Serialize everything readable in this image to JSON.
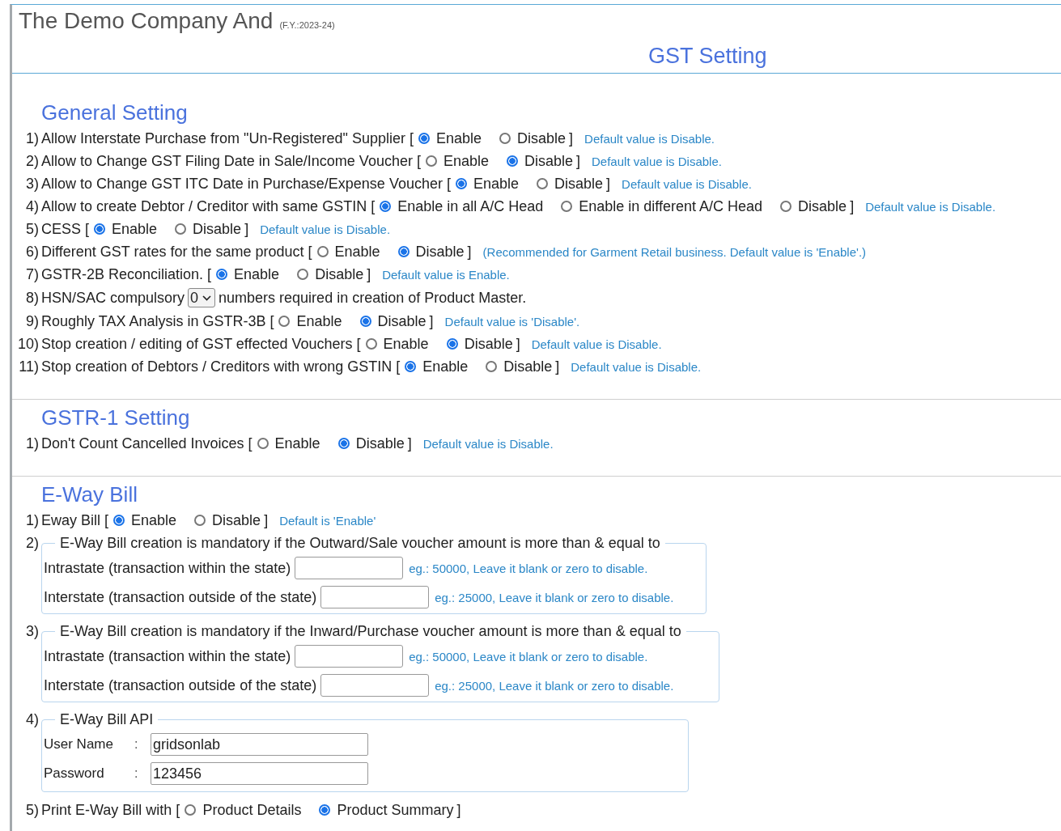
{
  "company": {
    "name": "The Demo Company And",
    "fy": "(F.Y.:2023-24)"
  },
  "page_title": "GST Setting",
  "sections": [
    {
      "title": "General Setting",
      "items": [
        {
          "kind": "radio",
          "number": "1)",
          "label": "Allow Interstate Purchase from \"Un-Registered\" Supplier [",
          "options": [
            {
              "label": "Enable",
              "selected": true
            },
            {
              "label": "Disable",
              "selected": false
            }
          ],
          "close": "]",
          "note": "Default value is Disable."
        },
        {
          "kind": "radio",
          "number": "2)",
          "label": "Allow to Change GST Filing Date in Sale/Income Voucher [",
          "options": [
            {
              "label": "Enable",
              "selected": false
            },
            {
              "label": "Disable",
              "selected": true
            }
          ],
          "close": "]",
          "note": "Default value is Disable."
        },
        {
          "kind": "radio",
          "number": "3)",
          "label": "Allow to Change GST ITC Date in Purchase/Expense Voucher [",
          "options": [
            {
              "label": "Enable",
              "selected": true
            },
            {
              "label": "Disable",
              "selected": false
            }
          ],
          "close": "]",
          "note": "Default value is Disable."
        },
        {
          "kind": "radio",
          "number": "4)",
          "label": "Allow to create Debtor / Creditor with same GSTIN [",
          "options": [
            {
              "label": "Enable in all A/C Head",
              "selected": true
            },
            {
              "label": "Enable in different A/C Head",
              "selected": false
            },
            {
              "label": "Disable",
              "selected": false
            }
          ],
          "close": "]",
          "note": "Default value is Disable."
        },
        {
          "kind": "radio",
          "number": "5)",
          "label": "CESS [",
          "options": [
            {
              "label": "Enable",
              "selected": true
            },
            {
              "label": "Disable",
              "selected": false
            }
          ],
          "close": "]",
          "note": "Default value is Disable."
        },
        {
          "kind": "radio",
          "number": "6)",
          "label": "Different GST rates for the same product [",
          "options": [
            {
              "label": "Enable",
              "selected": false
            },
            {
              "label": "Disable",
              "selected": true
            }
          ],
          "close": "]",
          "note": "(Recommended for Garment Retail business. Default value is 'Enable'.)"
        },
        {
          "kind": "radio",
          "number": "7)",
          "label": "GSTR-2B Reconciliation. [",
          "options": [
            {
              "label": "Enable",
              "selected": true
            },
            {
              "label": "Disable",
              "selected": false
            }
          ],
          "close": "]",
          "note": "Default value is Enable."
        },
        {
          "kind": "select",
          "number": "8)",
          "label": "HSN/SAC compulsory",
          "value": "0",
          "after": "numbers required in creation of Product Master."
        },
        {
          "kind": "radio",
          "number": "9)",
          "label": "Roughly TAX Analysis in GSTR-3B [",
          "options": [
            {
              "label": "Enable",
              "selected": false
            },
            {
              "label": "Disable",
              "selected": true
            }
          ],
          "close": "]",
          "note": "Default value is 'Disable'."
        },
        {
          "kind": "radio",
          "number": "10)",
          "label": "Stop creation / editing of GST effected Vouchers [",
          "options": [
            {
              "label": "Enable",
              "selected": false
            },
            {
              "label": "Disable",
              "selected": true
            }
          ],
          "close": "]",
          "note": "Default value is Disable."
        },
        {
          "kind": "radio",
          "number": "11)",
          "label": "Stop creation of Debtors / Creditors with wrong GSTIN [",
          "options": [
            {
              "label": "Enable",
              "selected": true
            },
            {
              "label": "Disable",
              "selected": false
            }
          ],
          "close": "]",
          "note": "Default value is Disable."
        }
      ]
    },
    {
      "title": "GSTR-1 Setting",
      "items": [
        {
          "kind": "radio",
          "number": "1)",
          "label": "Don't Count Cancelled Invoices [",
          "options": [
            {
              "label": "Enable",
              "selected": false
            },
            {
              "label": "Disable",
              "selected": true
            }
          ],
          "close": "]",
          "note": "Default value is Disable."
        }
      ]
    },
    {
      "title": "E-Way Bill",
      "items": [
        {
          "kind": "radio",
          "number": "1)",
          "label": "Eway Bill [",
          "options": [
            {
              "label": "Enable",
              "selected": true
            },
            {
              "label": "Disable",
              "selected": false
            }
          ],
          "close": "]",
          "note": "Default is 'Enable'"
        },
        {
          "kind": "amounts",
          "number": "2)",
          "legend": "E-Way Bill creation is mandatory if the Outward/Sale voucher amount is more than & equal to",
          "rows": [
            {
              "label": "Intrastate (transaction within the state)",
              "hint": "eg.: 50000, Leave it blank or zero to disable."
            },
            {
              "label": "Interstate (transaction outside of the state)",
              "hint": "eg.: 25000, Leave it blank or zero to disable."
            }
          ]
        },
        {
          "kind": "amounts",
          "number": "3)",
          "legend": "E-Way Bill creation is mandatory if the Inward/Purchase voucher amount is more than & equal to",
          "rows": [
            {
              "label": "Intrastate (transaction within the state)",
              "hint": "eg.: 50000, Leave it blank or zero to disable."
            },
            {
              "label": "Interstate (transaction outside of the state)",
              "hint": "eg.: 25000, Leave it blank or zero to disable."
            }
          ]
        },
        {
          "kind": "credentials",
          "number": "4)",
          "legend": "E-Way Bill API",
          "rows": [
            {
              "label": "User Name",
              "separator": ":",
              "value": "gridsonlab"
            },
            {
              "label": "Password",
              "separator": ":",
              "value": "123456"
            }
          ]
        },
        {
          "kind": "radio",
          "number": "5)",
          "label": "Print E-Way Bill with [",
          "options": [
            {
              "label": "Product Details",
              "selected": false
            },
            {
              "label": "Product Summary",
              "selected": true
            }
          ],
          "close": "]"
        }
      ]
    }
  ]
}
